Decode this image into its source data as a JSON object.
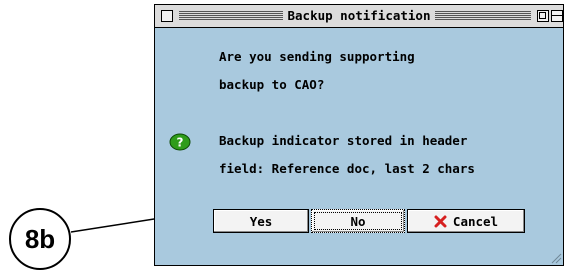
{
  "callout": {
    "label": "8b"
  },
  "window": {
    "title": "Backup notification",
    "question_lines": [
      "Are you sending supporting",
      "backup to CAO?"
    ],
    "info_lines": [
      "Backup indicator stored in header",
      "field: Reference doc, last 2 chars"
    ]
  },
  "buttons": {
    "yes": "Yes",
    "no": "No",
    "cancel": "Cancel"
  },
  "icons": {
    "info": "question-green-icon",
    "cancel": "red-x-icon"
  },
  "colors": {
    "dialog_bg": "#a9c9de",
    "icon_green": "#2f9c1a",
    "cancel_red": "#d62020"
  }
}
